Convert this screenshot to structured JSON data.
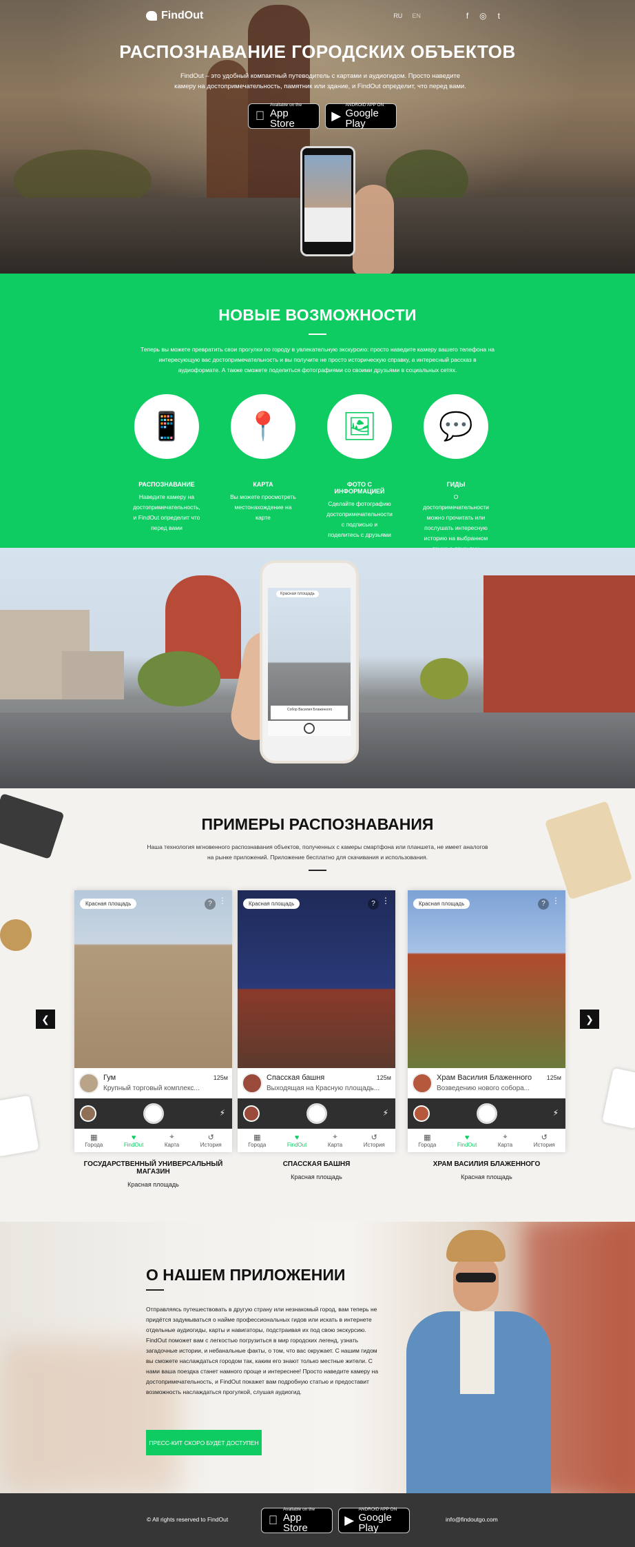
{
  "hero": {
    "logo": "FindOut",
    "langs": [
      "RU",
      "EN"
    ],
    "socials": [
      "f",
      "◎",
      "t"
    ],
    "title": "РАСПОЗНАВАНИЕ ГОРОДСКИХ ОБЪЕКТОВ",
    "description": "FindOut – это удобный компактный путеводитель с картами и аудиогидом. Просто наведите камеру на достопримечательность, памятник или здание, и FindOut определит, что перед вами.",
    "app_store": {
      "small": "Available on the",
      "big": "App Store"
    },
    "google_play": {
      "small": "ANDROID APP ON",
      "big": "Google Play"
    }
  },
  "features": {
    "title": "НОВЫЕ ВОЗМОЖНОСТИ",
    "description": "Теперь вы можете превратить свои прогулки по городу в увлекательную экскурсию: просто наведите камеру вашего телефона на интересующую вас достопримечательность и вы получите не просто историческую справку, а интересный рассказ в аудиоформате. А также сможете поделиться фотографиями со своими друзьями в социальных сетях.",
    "items": [
      {
        "title": "РАСПОЗНАВАНИЕ",
        "text": "Наведите камеру на достопримечательность, и FindOut определит что перед вами",
        "icon": "phone-hand-icon"
      },
      {
        "title": "КАРТА",
        "text": "Вы можете просмотреть местонахождение на карте",
        "icon": "map-pin-icon"
      },
      {
        "title": "ФОТО С ИНФОРМАЦИЕЙ",
        "text": "Сделайте фотографию достопримечательности с подписью и поделитесь с друзьями",
        "icon": "photos-icon"
      },
      {
        "title": "ГИДЫ",
        "text": "О достопримечательности можно прочитать или послушать интересную историю на выбранном языке с друзьями",
        "icon": "chat-icon"
      }
    ]
  },
  "photo_phone": {
    "tag": "Красная площадь",
    "info": "Собор Василия Блаженного"
  },
  "examples": {
    "title": "ПРИМЕРЫ РАСПОЗНАВАНИЯ",
    "description": "Наша технология мгновенного распознавания объектов, полученных с камеры смартфона или планшета, не имеет аналогов на рынке приложений. Приложение бесплатно для скачивания и использования.",
    "prev": "❮",
    "next": "❯",
    "cards": [
      {
        "pill": "Красная площадь",
        "name": "Гум",
        "dist": "125м",
        "sub": "Крупный торговый комплекс...",
        "caption": "ГОСУДАРСТВЕННЫЙ УНИВЕРСАЛЬНЫЙ МАГАЗИН",
        "caption_sub": "Красная площадь"
      },
      {
        "pill": "Красная площадь",
        "name": "Спасская башня",
        "dist": "125м",
        "sub": "Выходящая на Красную площадь...",
        "caption": "СПАССКАЯ БАШНЯ",
        "caption_sub": "Красная площадь"
      },
      {
        "pill": "Красная площадь",
        "name": "Храм Василия Блаженного",
        "dist": "125м",
        "sub": "Возведению нового собора...",
        "caption": "ХРАМ ВАСИЛИЯ БЛАЖЕННОГО",
        "caption_sub": "Красная площадь"
      }
    ],
    "tabs": [
      "Города",
      "FindOut",
      "Карта",
      "История"
    ]
  },
  "about": {
    "title": "О НАШЕМ ПРИЛОЖЕНИИ",
    "text": "Отправляясь путешествовать в другую страну или незнакомый город, вам теперь не придётся задумываться о найме профессиональных гидов или искать в интернете отдельные аудиогиды, карты и навигаторы, подстраивая их под свою экскурсию. FindOut поможет вам с легкостью погрузиться в мир городских легенд, узнать загадочные истории, и небанальные факты, о том, что вас окружает. С нашим гидом вы сможете наслаждаться городом так, каким его знают только местные жители. С нами ваша поездка станет намного проще и интереснее! Просто наведите камеру на достопримечательность, и FindOut покажет вам подробную статью и предоставит возможность наслаждаться прогулкой, слушая аудиогид.",
    "press_button": "ПРЕСС-КИТ СКОРО БУДЕТ ДОСТУПЕН"
  },
  "footer": {
    "copyright": "© All rights reserved to FindOut",
    "app_store": {
      "small": "Available on the",
      "big": "App Store"
    },
    "google_play": {
      "small": "ANDROID APP ON",
      "big": "Google Play"
    },
    "email": "info@findoutgo.com"
  }
}
